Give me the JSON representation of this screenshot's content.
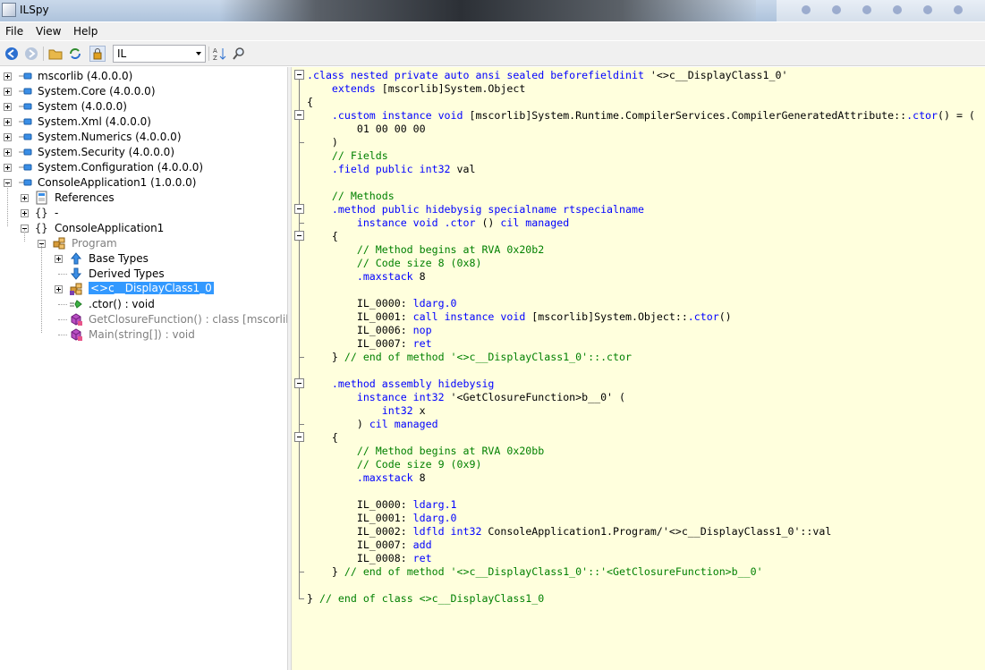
{
  "window": {
    "title": "ILSpy"
  },
  "menu": [
    "File",
    "View",
    "Help"
  ],
  "toolbar": {
    "language": "IL"
  },
  "tree": [
    {
      "label": "mscorlib (4.0.0.0)",
      "indent": 0,
      "toggle": "plus",
      "icon": "assembly-icon"
    },
    {
      "label": "System.Core (4.0.0.0)",
      "indent": 0,
      "toggle": "plus",
      "icon": "assembly-icon"
    },
    {
      "label": "System (4.0.0.0)",
      "indent": 0,
      "toggle": "plus",
      "icon": "assembly-icon"
    },
    {
      "label": "System.Xml (4.0.0.0)",
      "indent": 0,
      "toggle": "plus",
      "icon": "assembly-icon"
    },
    {
      "label": "System.Numerics (4.0.0.0)",
      "indent": 0,
      "toggle": "plus",
      "icon": "assembly-icon"
    },
    {
      "label": "System.Security (4.0.0.0)",
      "indent": 0,
      "toggle": "plus",
      "icon": "assembly-icon"
    },
    {
      "label": "System.Configuration (4.0.0.0)",
      "indent": 0,
      "toggle": "plus",
      "icon": "assembly-icon"
    },
    {
      "label": "ConsoleApplication1 (1.0.0.0)",
      "indent": 0,
      "toggle": "minus",
      "icon": "assembly-icon"
    },
    {
      "label": "References",
      "indent": 1,
      "toggle": "plus",
      "icon": "references-icon"
    },
    {
      "label": "-",
      "indent": 1,
      "toggle": "plus",
      "icon": "namespace-icon"
    },
    {
      "label": "ConsoleApplication1",
      "indent": 1,
      "toggle": "minus",
      "icon": "namespace-icon"
    },
    {
      "label": "Program",
      "indent": 2,
      "toggle": "minus",
      "icon": "class-icon",
      "gray": true
    },
    {
      "label": "Base Types",
      "indent": 3,
      "toggle": "plus",
      "icon": "base-types-icon"
    },
    {
      "label": "Derived Types",
      "indent": 3,
      "toggle": "",
      "icon": "derived-types-icon"
    },
    {
      "label": "<>c__DisplayClass1_0",
      "indent": 3,
      "toggle": "plus",
      "icon": "nested-class-icon",
      "selected": true
    },
    {
      "label": ".ctor() : void",
      "indent": 3,
      "toggle": "",
      "icon": "constructor-icon"
    },
    {
      "label": "GetClosureFunction() : class [mscorlib]",
      "indent": 3,
      "toggle": "",
      "icon": "method-icon",
      "gray": true
    },
    {
      "label": "Main(string[]) : void",
      "indent": 3,
      "toggle": "",
      "icon": "method-icon",
      "gray": true
    }
  ],
  "code": [
    [
      {
        "k": 1,
        "t": ".class nested private auto ansi sealed beforefieldinit"
      },
      {
        "t": " '<>c__DisplayClass1_0'"
      }
    ],
    [
      {
        "t": "    "
      },
      {
        "k": 1,
        "t": "extends"
      },
      {
        "t": " [mscorlib]System.Object"
      }
    ],
    [
      {
        "t": "{"
      }
    ],
    [
      {
        "t": "    "
      },
      {
        "k": 1,
        "t": ".custom instance void"
      },
      {
        "t": " [mscorlib]System.Runtime.CompilerServices.CompilerGeneratedAttribute::"
      },
      {
        "k": 1,
        "t": ".ctor"
      },
      {
        "t": "() = ("
      }
    ],
    [
      {
        "t": "        01 00 00 00"
      }
    ],
    [
      {
        "t": "    )"
      }
    ],
    [
      {
        "t": "    "
      },
      {
        "c": 1,
        "t": "// Fields"
      }
    ],
    [
      {
        "t": "    "
      },
      {
        "k": 1,
        "t": ".field public int32"
      },
      {
        "t": " val"
      }
    ],
    [
      {
        "t": ""
      }
    ],
    [
      {
        "t": "    "
      },
      {
        "c": 1,
        "t": "// Methods"
      }
    ],
    [
      {
        "t": "    "
      },
      {
        "k": 1,
        "t": ".method public hidebysig specialname rtspecialname"
      }
    ],
    [
      {
        "t": "        "
      },
      {
        "k": 1,
        "t": "instance void .ctor"
      },
      {
        "t": " () "
      },
      {
        "k": 1,
        "t": "cil managed"
      }
    ],
    [
      {
        "t": "    {"
      }
    ],
    [
      {
        "t": "        "
      },
      {
        "c": 1,
        "t": "// Method begins at RVA 0x20b2"
      }
    ],
    [
      {
        "t": "        "
      },
      {
        "c": 1,
        "t": "// Code size 8 (0x8)"
      }
    ],
    [
      {
        "t": "        "
      },
      {
        "k": 1,
        "t": ".maxstack"
      },
      {
        "t": " 8"
      }
    ],
    [
      {
        "t": ""
      }
    ],
    [
      {
        "t": "        IL_0000: "
      },
      {
        "k": 1,
        "t": "ldarg.0"
      }
    ],
    [
      {
        "t": "        IL_0001: "
      },
      {
        "k": 1,
        "t": "call instance void"
      },
      {
        "t": " [mscorlib]System.Object::"
      },
      {
        "k": 1,
        "t": ".ctor"
      },
      {
        "t": "()"
      }
    ],
    [
      {
        "t": "        IL_0006: "
      },
      {
        "k": 1,
        "t": "nop"
      }
    ],
    [
      {
        "t": "        IL_0007: "
      },
      {
        "k": 1,
        "t": "ret"
      }
    ],
    [
      {
        "t": "    } "
      },
      {
        "c": 1,
        "t": "// end of method '<>c__DisplayClass1_0'::.ctor"
      }
    ],
    [
      {
        "t": ""
      }
    ],
    [
      {
        "t": "    "
      },
      {
        "k": 1,
        "t": ".method assembly hidebysig"
      }
    ],
    [
      {
        "t": "        "
      },
      {
        "k": 1,
        "t": "instance int32"
      },
      {
        "t": " '<GetClosureFunction>b__0' ("
      }
    ],
    [
      {
        "t": "            "
      },
      {
        "k": 1,
        "t": "int32"
      },
      {
        "t": " x"
      }
    ],
    [
      {
        "t": "        ) "
      },
      {
        "k": 1,
        "t": "cil managed"
      }
    ],
    [
      {
        "t": "    {"
      }
    ],
    [
      {
        "t": "        "
      },
      {
        "c": 1,
        "t": "// Method begins at RVA 0x20bb"
      }
    ],
    [
      {
        "t": "        "
      },
      {
        "c": 1,
        "t": "// Code size 9 (0x9)"
      }
    ],
    [
      {
        "t": "        "
      },
      {
        "k": 1,
        "t": ".maxstack"
      },
      {
        "t": " 8"
      }
    ],
    [
      {
        "t": ""
      }
    ],
    [
      {
        "t": "        IL_0000: "
      },
      {
        "k": 1,
        "t": "ldarg.1"
      }
    ],
    [
      {
        "t": "        IL_0001: "
      },
      {
        "k": 1,
        "t": "ldarg.0"
      }
    ],
    [
      {
        "t": "        IL_0002: "
      },
      {
        "k": 1,
        "t": "ldfld int32"
      },
      {
        "t": " ConsoleApplication1.Program/'<>c__DisplayClass1_0'::val"
      }
    ],
    [
      {
        "t": "        IL_0007: "
      },
      {
        "k": 1,
        "t": "add"
      }
    ],
    [
      {
        "t": "        IL_0008: "
      },
      {
        "k": 1,
        "t": "ret"
      }
    ],
    [
      {
        "t": "    } "
      },
      {
        "c": 1,
        "t": "// end of method '<>c__DisplayClass1_0'::'<GetClosureFunction>b__0'"
      }
    ],
    [
      {
        "t": ""
      }
    ],
    [
      {
        "t": "} "
      },
      {
        "c": 1,
        "t": "// end of class <>c__DisplayClass1_0"
      }
    ]
  ]
}
